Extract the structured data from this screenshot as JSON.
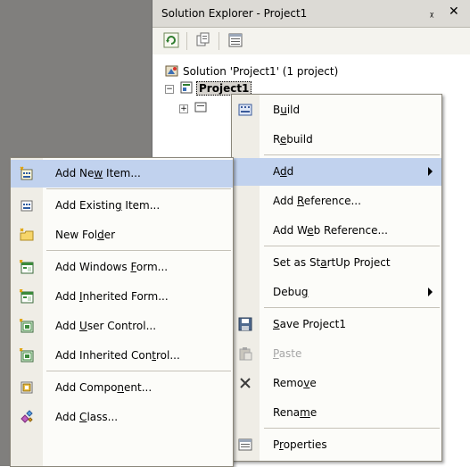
{
  "panel": {
    "title": "Solution Explorer - Project1",
    "pin_glyph": "ᵽ",
    "close_glyph": "✕",
    "toolbar_icons": [
      "refresh-icon",
      "show-all-files-icon",
      "properties-icon"
    ]
  },
  "tree": {
    "solution_label": "Solution 'Project1' (1 project)",
    "project_label": "Project1",
    "expand_glyph": "−",
    "collapse_glyph": "+"
  },
  "context_menu": {
    "items": [
      {
        "pre": "B",
        "u": "u",
        "post": "ild",
        "icon": "build-icon"
      },
      {
        "pre": "R",
        "u": "e",
        "post": "build"
      },
      {
        "pre": "A",
        "u": "d",
        "post": "d",
        "submenu": true
      },
      {
        "pre": "Add ",
        "u": "R",
        "post": "eference..."
      },
      {
        "pre": "Add W",
        "u": "e",
        "post": "b Reference..."
      },
      {
        "pre": "Set as St",
        "u": "a",
        "post": "rtUp Project"
      },
      {
        "pre": "Debu",
        "u": "g",
        "post": "",
        "submenu": true
      },
      {
        "pre": "",
        "u": "S",
        "post": "ave Project1",
        "icon": "save-icon"
      },
      {
        "pre": "",
        "u": "P",
        "post": "aste",
        "icon": "paste-icon",
        "disabled": true
      },
      {
        "pre": "Remo",
        "u": "v",
        "post": "e",
        "icon": "delete-icon"
      },
      {
        "pre": "Rena",
        "u": "m",
        "post": "e"
      },
      {
        "pre": "P",
        "u": "r",
        "post": "operties",
        "icon": "properties-icon"
      }
    ]
  },
  "add_submenu": {
    "items": [
      {
        "pre": "Add Ne",
        "u": "w",
        "post": " Item...",
        "icon": "new-item-icon"
      },
      {
        "pre": "Add Existin",
        "u": "g",
        "post": " Item...",
        "icon": "existing-item-icon"
      },
      {
        "pre": "New Fol",
        "u": "d",
        "post": "er",
        "icon": "new-folder-icon"
      },
      {
        "pre": "Add Windows ",
        "u": "F",
        "post": "orm...",
        "icon": "windows-form-icon"
      },
      {
        "pre": "Add ",
        "u": "I",
        "post": "nherited Form...",
        "icon": "inherited-form-icon"
      },
      {
        "pre": "Add ",
        "u": "U",
        "post": "ser Control...",
        "icon": "user-control-icon"
      },
      {
        "pre": "Add Inherited Con",
        "u": "t",
        "post": "rol...",
        "icon": "inherited-control-icon"
      },
      {
        "pre": "Add Compo",
        "u": "n",
        "post": "ent...",
        "icon": "component-icon"
      },
      {
        "pre": "Add ",
        "u": "C",
        "post": "lass...",
        "icon": "class-icon"
      }
    ]
  },
  "colors": {
    "highlight": "#c1d2ee",
    "menu_bg": "#fcfcf9",
    "gutter": "#efede6",
    "desktop": "#807f7d",
    "disabled_text": "#a6a6a6"
  }
}
